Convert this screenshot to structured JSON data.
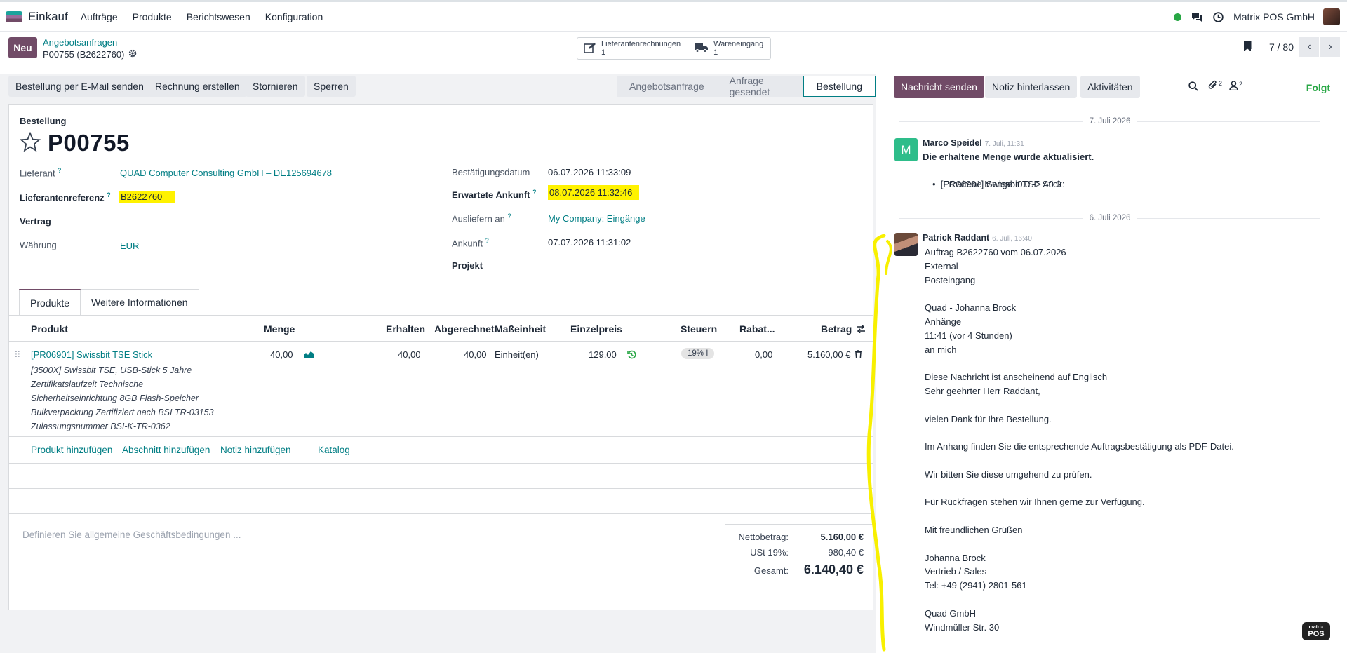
{
  "navbar": {
    "app_name": "Einkauf",
    "menu": [
      "Aufträge",
      "Produkte",
      "Berichtswesen",
      "Konfiguration"
    ],
    "company": "Matrix POS GmbH"
  },
  "control": {
    "new_label": "Neu",
    "breadcrumb": "Angebotsanfragen",
    "record": "P00755 (B2622760)",
    "smart_buttons": [
      {
        "label": "Lieferantenrechnungen",
        "count": "1"
      },
      {
        "label": "Wareneingang",
        "count": "1"
      }
    ],
    "pager": "7 / 80"
  },
  "actions": [
    "Bestellung per E-Mail senden",
    "Rechnung erstellen",
    "Stornieren",
    "Sperren"
  ],
  "stages": [
    "Angebotsanfrage",
    "Anfrage gesendet",
    "Bestellung"
  ],
  "form": {
    "doc_type": "Bestellung",
    "name": "P00755",
    "fields": {
      "lieferant_label": "Lieferant",
      "lieferant": "QUAD Computer Consulting GmbH – DE125694678",
      "ref_label": "Lieferantenreferenz",
      "ref": "B2622760",
      "vertrag_label": "Vertrag",
      "waehrung_label": "Währung",
      "waehrung": "EUR",
      "bestaetigung_label": "Bestätigungsdatum",
      "bestaetigung": "06.07.2026 11:33:09",
      "erwartete_label": "Erwartete Ankunft",
      "erwartete": "08.07.2026 11:32:46",
      "ausliefern_label": "Ausliefern an",
      "ausliefern": "My Company: Eingänge",
      "ankunft_label": "Ankunft",
      "ankunft": "07.07.2026 11:31:02",
      "projekt_label": "Projekt"
    },
    "tabs": [
      "Produkte",
      "Weitere Informationen"
    ],
    "columns": {
      "produkt": "Produkt",
      "menge": "Menge",
      "erhalten": "Erhalten",
      "abgerechnet": "Abgerechnet",
      "einheit": "Maßeinheit",
      "preis": "Einzelpreis",
      "steuern": "Steuern",
      "rabatt": "Rabat...",
      "betrag": "Betrag"
    },
    "line": {
      "product": "[PR06901] Swissbit TSE Stick",
      "description": "[3500X] Swissbit TSE, USB-Stick 5 Jahre\nZertifikatslaufzeit Technische\nSicherheitseinrichtung 8GB Flash-Speicher\nBulkverpackung Zertifiziert nach BSI TR-03153\nZulassungsnummer BSI-K-TR-0362",
      "menge": "40,00",
      "erhalten": "40,00",
      "abgerechnet": "40,00",
      "einheit": "Einheit(en)",
      "preis": "129,00",
      "steuer": "19% I",
      "rabatt": "0,00",
      "betrag": "5.160,00 €"
    },
    "add_links": [
      "Produkt hinzufügen",
      "Abschnitt hinzufügen",
      "Notiz hinzufügen",
      "Katalog"
    ],
    "terms_placeholder": "Definieren Sie allgemeine Geschäftsbedingungen ...",
    "totals": {
      "netto_label": "Nettobetrag:",
      "netto": "5.160,00 €",
      "ust_label": "USt 19%:",
      "ust": "980,40 €",
      "gesamt_label": "Gesamt:",
      "gesamt": "6.140,40 €"
    }
  },
  "chatter": {
    "send": "Nachricht senden",
    "note": "Notiz hinterlassen",
    "activities": "Aktivitäten",
    "attachments_count": "2",
    "followers_count": "2",
    "follow": "Folgt",
    "date1": "7. Juli 2026",
    "msg1": {
      "initial": "M",
      "author": "Marco Speidel",
      "time": "7. Juli, 11:31",
      "subject": "Die erhaltene Menge wurde aktualisiert.",
      "item": "[PR06901] Swissbit TSE Stick:",
      "change": "Erhaltene Menge: 0.0 -> 40.0"
    },
    "date2": "6. Juli 2026",
    "msg2": {
      "author": "Patrick Raddant",
      "time": "6. Juli, 16:40",
      "body": "Auftrag B2622760 vom 06.07.2026\nExternal\nPosteingang\n\nQuad - Johanna Brock\nAnhänge\n11:41 (vor 4 Stunden)\nan mich\n\nDiese Nachricht ist anscheinend auf Englisch\nSehr geehrter Herr Raddant,\n\nvielen Dank für Ihre Bestellung.\n\nIm Anhang finden Sie die entsprechende Auftragsbestätigung als PDF-Datei.\n\nWir bitten Sie diese umgehend zu prüfen.\n\nFür Rückfragen stehen wir Ihnen gerne zur Verfügung.\n\nMit freundlichen Grüßen\n\nJohanna Brock\nVertrieb / Sales\nTel: +49 (2941) 2801-561\n\nQuad GmbH\nWindmüller Str. 30"
    }
  },
  "logo": {
    "top": "matrix",
    "bottom": "POS"
  },
  "colors": {
    "brand": "#714b67",
    "link": "#017e84",
    "highlight": "#fff200",
    "follow": "#28a745"
  }
}
